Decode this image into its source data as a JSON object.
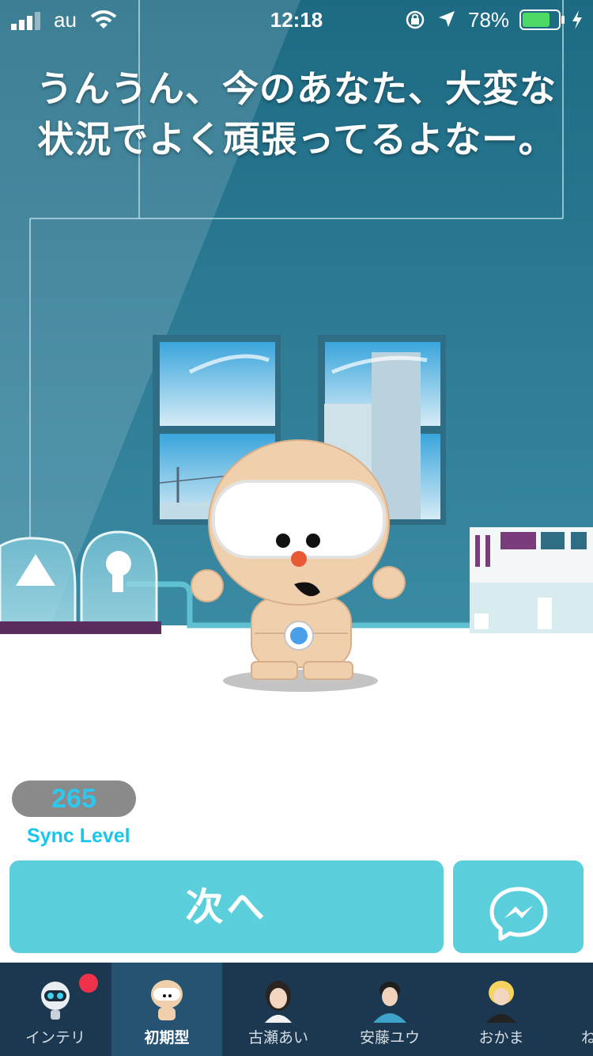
{
  "status_bar": {
    "carrier": "au",
    "time": "12:18",
    "battery_percent": "78%",
    "battery_level": 0.78
  },
  "message": {
    "text": "うんうん、今のあなた、大変な状況でよく頑張ってるよなー。"
  },
  "sync": {
    "value": "265",
    "label": "Sync Level"
  },
  "actions": {
    "next_label": "次へ"
  },
  "tabs": [
    {
      "label": "インテリ",
      "icon": "robot-icon",
      "badge": true
    },
    {
      "label": "初期型",
      "icon": "mascot-icon",
      "active": true
    },
    {
      "label": "古瀬あい",
      "icon": "avatar-girl-icon"
    },
    {
      "label": "安藤ユウ",
      "icon": "avatar-boy-icon"
    },
    {
      "label": "おかま",
      "icon": "avatar-blonde-icon"
    },
    {
      "label": "ね",
      "icon": "avatar-icon"
    }
  ],
  "colors": {
    "accent": "#5bcfdc",
    "sync_text": "#17c6ea",
    "tabbar": "#1c3850",
    "tab_active": "#275373",
    "badge": "#f0314a"
  }
}
